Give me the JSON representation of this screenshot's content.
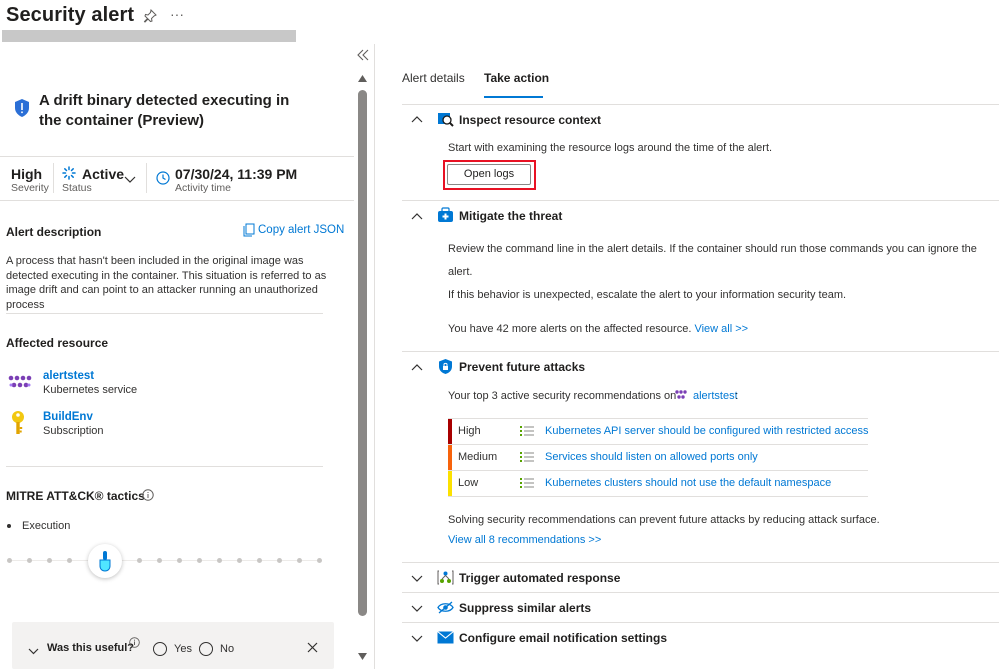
{
  "header": {
    "title": "Security alert"
  },
  "alert": {
    "name": "A drift binary detected executing in the container (Preview)",
    "severity_value": "High",
    "severity_label": "Severity",
    "status_value": "Active",
    "status_label": "Status",
    "activity_value": "07/30/24, 11:39 PM",
    "activity_label": "Activity time"
  },
  "description": {
    "title": "Alert description",
    "copy_json": "Copy alert JSON",
    "text": "A process that hasn't been included in the original image was detected executing in the container. This situation is referred to as image drift and can point to an attacker running an unauthorized process"
  },
  "affected": {
    "title": "Affected resource",
    "items": [
      {
        "name": "alertstest",
        "type": "Kubernetes service",
        "icon": "kubernetes-icon"
      },
      {
        "name": "BuildEnv",
        "type": "Subscription",
        "icon": "key-icon"
      }
    ]
  },
  "mitre": {
    "title": "MITRE ATT&CK® tactics",
    "tactic": "Execution"
  },
  "feedback": {
    "question": "Was this useful?",
    "yes": "Yes",
    "no": "No"
  },
  "tabs": [
    {
      "label": "Alert details",
      "active": false
    },
    {
      "label": "Take action",
      "active": true
    }
  ],
  "inspect": {
    "title": "Inspect resource context",
    "text": "Start with examining the resource logs around the time of the alert.",
    "button": "Open logs"
  },
  "mitigate": {
    "title": "Mitigate the threat",
    "line1": "Review the command line in the alert details. If the container should run those commands you can ignore the",
    "line2": "alert.",
    "line3": "If this behavior is unexpected, escalate the alert to your information security team.",
    "more_text": "You have 42 more alerts on the affected resource.",
    "view_all": "View all >>"
  },
  "prevent": {
    "title": "Prevent future attacks",
    "intro": "Your top 3 active security recommendations on",
    "resource": "alertstest",
    "colon": ":",
    "recommendations": [
      {
        "severity": "High",
        "color": "#a80000",
        "text": "Kubernetes API server should be configured with restricted access"
      },
      {
        "severity": "Medium",
        "color": "#f7630c",
        "text": "Services should listen on allowed ports only"
      },
      {
        "severity": "Low",
        "color": "#fce100",
        "text": "Kubernetes clusters should not use the default namespace"
      }
    ],
    "footer": "Solving security recommendations can prevent future attacks by reducing attack surface.",
    "view_all": "View all 8 recommendations >>"
  },
  "collapsed_sections": [
    {
      "title": "Trigger automated response",
      "icon": "automation-icon"
    },
    {
      "title": "Suppress similar alerts",
      "icon": "eye-icon"
    },
    {
      "title": "Configure email notification settings",
      "icon": "email-icon"
    }
  ]
}
